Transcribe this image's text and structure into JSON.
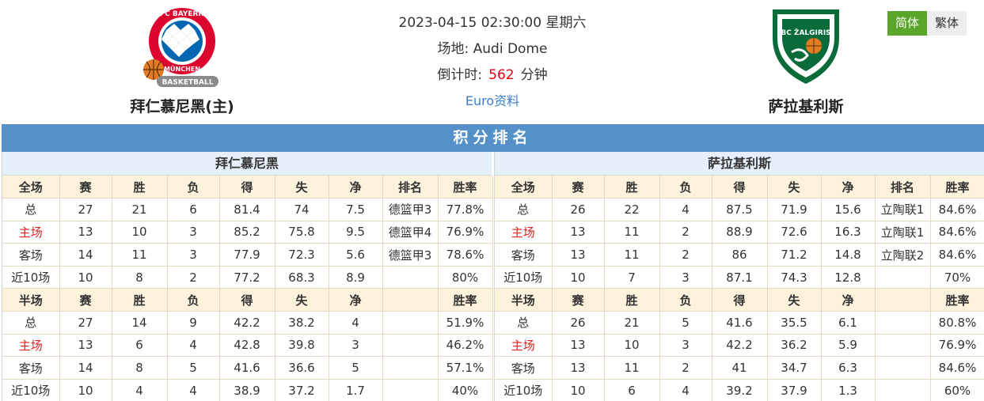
{
  "header": {
    "datetime": "2023-04-15 02:30:00 星期六",
    "venue_label": "场地:",
    "venue": "Audi Dome",
    "countdown_label": "倒计时:",
    "countdown_value": "562",
    "countdown_unit": "分钟",
    "euro_link": "Euro资料",
    "home_team": "拜仁慕尼黑(主)",
    "away_team": "萨拉基利斯",
    "home_logo_text": "FC BAYERN MÜNCHEN BASKETBALL",
    "away_logo_text": "BC ŽALGIRIS"
  },
  "lang": {
    "simplified": "简体",
    "traditional": "繁体"
  },
  "section_title": "积分排名",
  "colors": {
    "accent_green": "#5aa62a",
    "title_blue": "#5590c8",
    "red": "#e0201c"
  },
  "tables": [
    {
      "team": "拜仁慕尼黑",
      "full_header": [
        "全场",
        "赛",
        "胜",
        "负",
        "得",
        "失",
        "净",
        "排名",
        "胜率"
      ],
      "full_rows": [
        [
          "总",
          "27",
          "21",
          "6",
          "81.4",
          "74",
          "7.5",
          "德篮甲3",
          "77.8%"
        ],
        [
          "主场",
          "13",
          "10",
          "3",
          "85.2",
          "75.8",
          "9.5",
          "德篮甲4",
          "76.9%"
        ],
        [
          "客场",
          "14",
          "11",
          "3",
          "77.9",
          "72.3",
          "5.6",
          "德篮甲3",
          "78.6%"
        ],
        [
          "近10场",
          "10",
          "8",
          "2",
          "77.2",
          "68.3",
          "8.9",
          "",
          "80%"
        ]
      ],
      "half_header": [
        "半场",
        "赛",
        "胜",
        "负",
        "得",
        "失",
        "净",
        "",
        "胜率"
      ],
      "half_rows": [
        [
          "总",
          "27",
          "14",
          "9",
          "42.2",
          "38.2",
          "4",
          "",
          "51.9%"
        ],
        [
          "主场",
          "13",
          "6",
          "4",
          "42.8",
          "39.8",
          "3",
          "",
          "46.2%"
        ],
        [
          "客场",
          "14",
          "8",
          "5",
          "41.6",
          "36.6",
          "5",
          "",
          "57.1%"
        ],
        [
          "近10场",
          "10",
          "4",
          "4",
          "38.9",
          "37.2",
          "1.7",
          "",
          "40%"
        ]
      ]
    },
    {
      "team": "萨拉基利斯",
      "full_header": [
        "全场",
        "赛",
        "胜",
        "负",
        "得",
        "失",
        "净",
        "排名",
        "胜率"
      ],
      "full_rows": [
        [
          "总",
          "26",
          "22",
          "4",
          "87.5",
          "71.9",
          "15.6",
          "立陶联1",
          "84.6%"
        ],
        [
          "主场",
          "13",
          "11",
          "2",
          "88.9",
          "72.6",
          "16.3",
          "立陶联1",
          "84.6%"
        ],
        [
          "客场",
          "13",
          "11",
          "2",
          "86",
          "71.2",
          "14.8",
          "立陶联2",
          "84.6%"
        ],
        [
          "近10场",
          "10",
          "7",
          "3",
          "87.1",
          "74.3",
          "12.8",
          "",
          "70%"
        ]
      ],
      "half_header": [
        "半场",
        "赛",
        "胜",
        "负",
        "得",
        "失",
        "净",
        "",
        "胜率"
      ],
      "half_rows": [
        [
          "总",
          "26",
          "21",
          "5",
          "41.6",
          "35.5",
          "6.1",
          "",
          "80.8%"
        ],
        [
          "主场",
          "13",
          "10",
          "3",
          "42.2",
          "36.2",
          "5.9",
          "",
          "76.9%"
        ],
        [
          "客场",
          "13",
          "11",
          "2",
          "41",
          "34.7",
          "6.3",
          "",
          "84.6%"
        ],
        [
          "近10场",
          "10",
          "6",
          "4",
          "39.2",
          "37.9",
          "1.3",
          "",
          "60%"
        ]
      ]
    }
  ]
}
